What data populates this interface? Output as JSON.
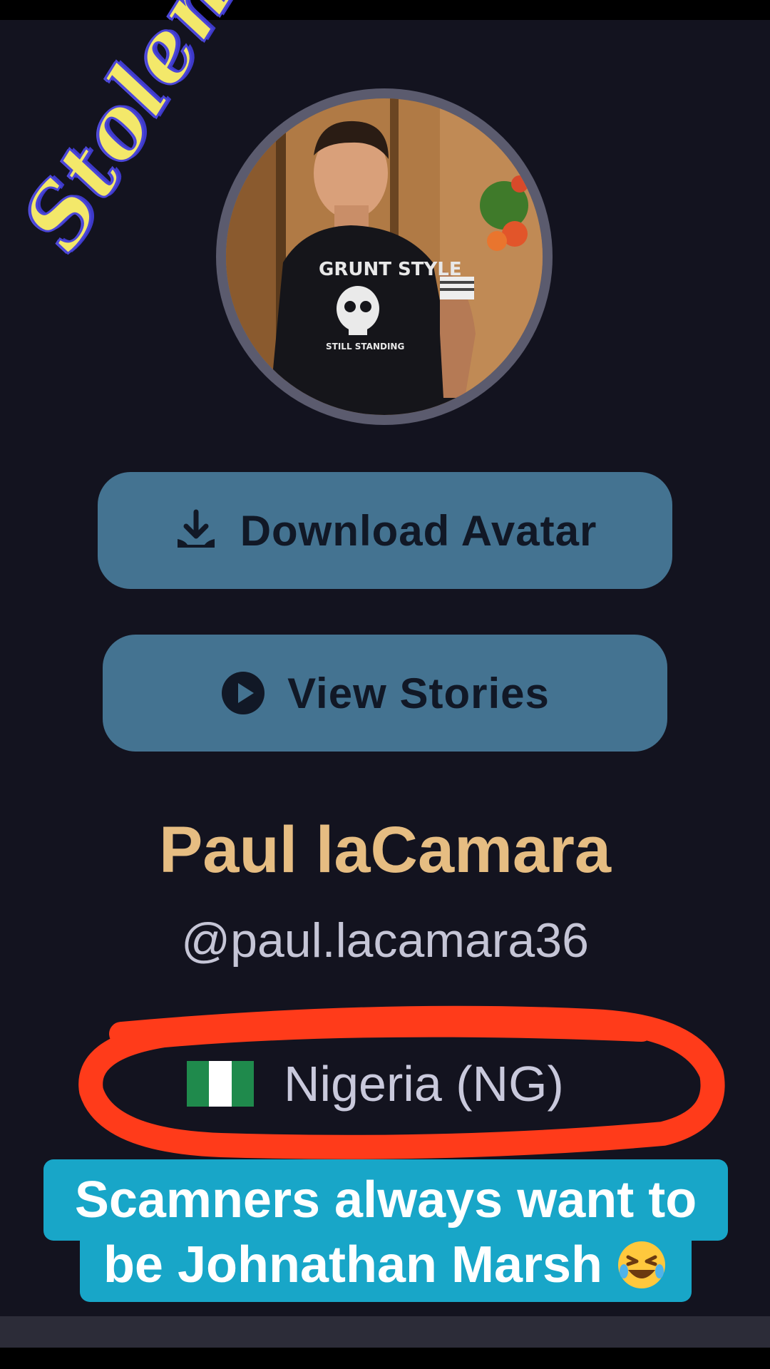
{
  "overlay": {
    "stamp_text": "Stolen"
  },
  "profile": {
    "avatar_shirt_text": "GRUNT STYLE",
    "avatar_shirt_subtext": "STILL STANDING",
    "download_label": "Download Avatar",
    "stories_label": "View Stories",
    "display_name": "Paul laCamara",
    "username": "@paul.lacamara36",
    "country": "Nigeria (NG)"
  },
  "caption": {
    "line1": "Scamners  always want to",
    "line2": "be Johnathan Marsh"
  },
  "icons": {
    "download": "download-icon",
    "stories": "play-circle-icon",
    "flag": "nigeria-flag-icon",
    "emoji": "rolling-laughing-emoji-icon"
  },
  "colors": {
    "background": "#13131f",
    "button": "#447391",
    "name": "#e6bd82",
    "highlight": "#ff3b1a",
    "caption_bg": "#18a6c8"
  }
}
